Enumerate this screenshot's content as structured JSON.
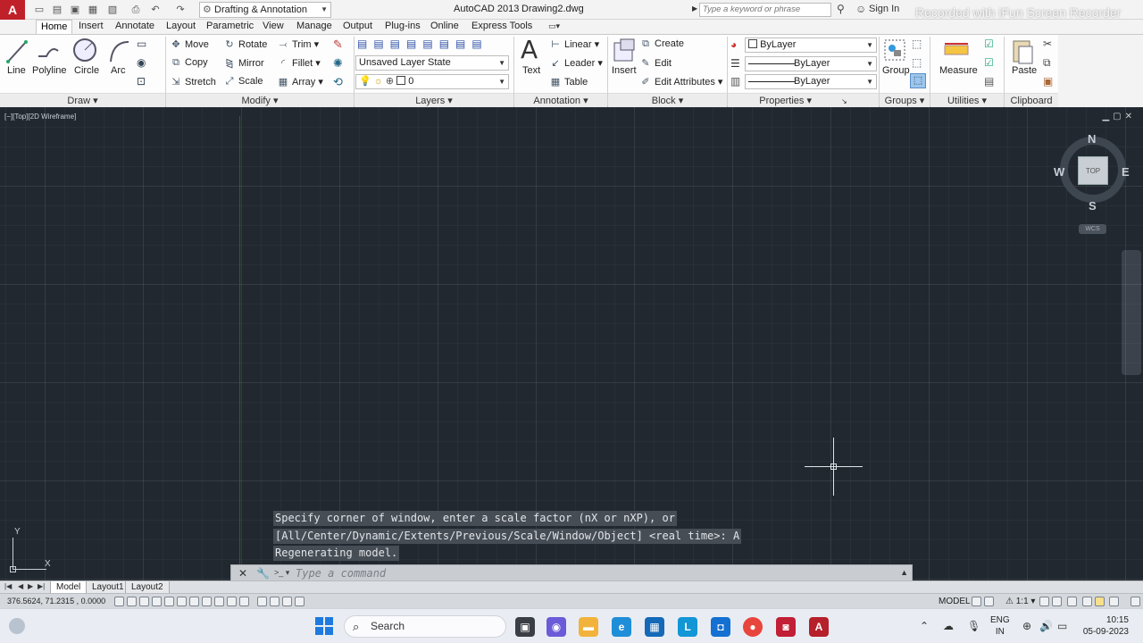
{
  "titlebar": {
    "workspace": "Drafting & Annotation",
    "app_title": "AutoCAD 2013",
    "doc_title": "Drawing2.dwg",
    "search_placeholder": "Type a keyword or phrase",
    "sign_in": "Sign In",
    "watermark": "Recorded with iFun Screen Recorder"
  },
  "tabs": [
    "Home",
    "Insert",
    "Annotate",
    "Layout",
    "Parametric",
    "View",
    "Manage",
    "Output",
    "Plug-ins",
    "Online",
    "Express Tools"
  ],
  "ribbon": {
    "draw": {
      "title": "Draw",
      "line": "Line",
      "polyline": "Polyline",
      "circle": "Circle",
      "arc": "Arc"
    },
    "modify": {
      "title": "Modify",
      "move": "Move",
      "rotate": "Rotate",
      "trim": "Trim",
      "copy": "Copy",
      "mirror": "Mirror",
      "fillet": "Fillet",
      "stretch": "Stretch",
      "scale": "Scale",
      "array": "Array"
    },
    "layers": {
      "title": "Layers",
      "layer_state": "Unsaved Layer State",
      "current_layer": "0"
    },
    "annotation": {
      "title": "Annotation",
      "text": "Text",
      "linear": "Linear",
      "leader": "Leader",
      "table": "Table"
    },
    "block": {
      "title": "Block",
      "insert": "Insert",
      "create": "Create",
      "edit": "Edit",
      "edit_attributes": "Edit Attributes"
    },
    "properties": {
      "title": "Properties",
      "color": "ByLayer",
      "linetype": "ByLayer",
      "lineweight": "ByLayer"
    },
    "groups": {
      "title": "Groups",
      "group": "Group"
    },
    "utilities": {
      "title": "Utilities",
      "measure": "Measure"
    },
    "clipboard": {
      "title": "Clipboard",
      "paste": "Paste"
    }
  },
  "viewport": {
    "label": "[−][Top][2D Wireframe]",
    "viewcube_top": "TOP",
    "compass_n": "N",
    "compass_s": "S",
    "compass_e": "E",
    "compass_w": "W",
    "wcs": "WCS",
    "ucs_x": "X",
    "ucs_y": "Y"
  },
  "command": {
    "history": [
      "Specify corner of window, enter a scale factor (nX or nXP), or",
      "[All/Center/Dynamic/Extents/Previous/Scale/Window/Object] <real time>: A",
      "Regenerating model."
    ],
    "placeholder": "Type a command"
  },
  "layout_tabs": [
    "Model",
    "Layout1",
    "Layout2"
  ],
  "statusbar": {
    "coords": "376.5624, 71.2315 , 0.0000",
    "model": "MODEL",
    "scale": "1:1"
  },
  "taskbar": {
    "search": "Search",
    "lang1": "ENG",
    "lang2": "IN",
    "time": "10:15",
    "date": "05-09-2023"
  },
  "colors": {
    "canvas_bg": "#212830",
    "brand_red": "#c0202a"
  }
}
